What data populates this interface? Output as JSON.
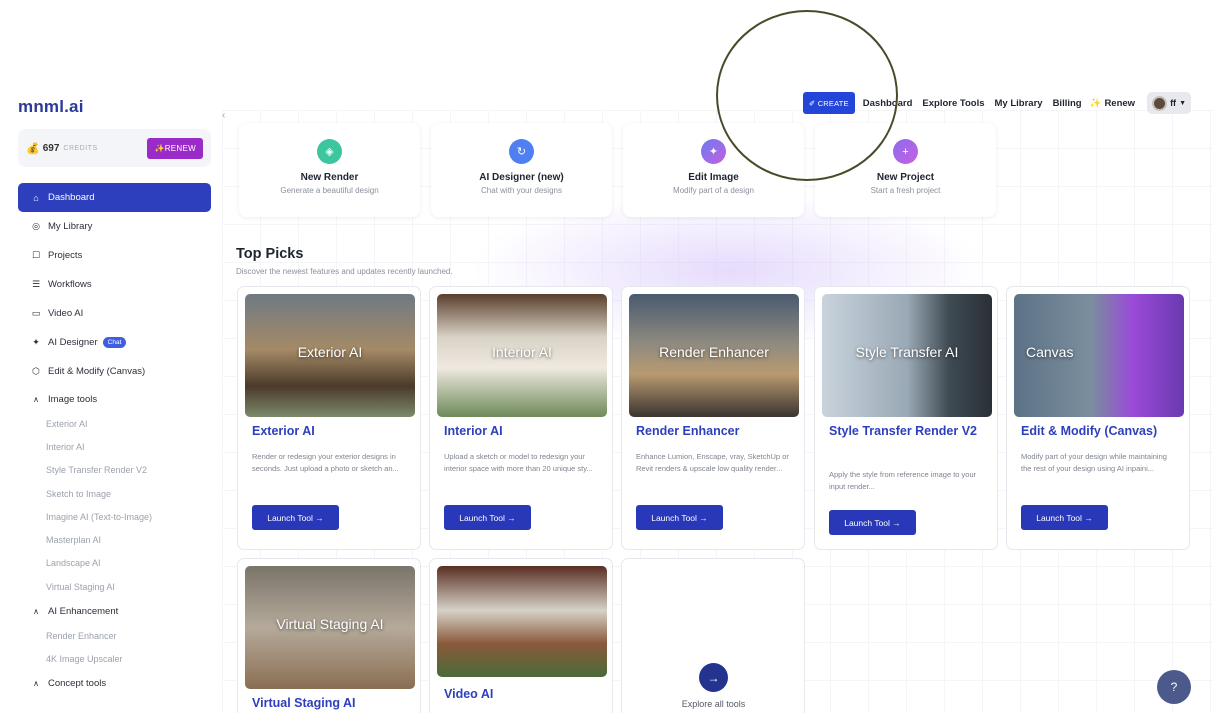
{
  "brand": "mnml.ai",
  "credits": {
    "count": "697",
    "label": "CREDITS",
    "renew": "✨RENEW"
  },
  "nav": [
    {
      "label": "Dashboard",
      "icon": "home-icon",
      "glyph": "⌂"
    },
    {
      "label": "My Library",
      "icon": "library-icon",
      "glyph": "◎"
    },
    {
      "label": "Projects",
      "icon": "projects-icon",
      "glyph": "☐"
    },
    {
      "label": "Workflows",
      "icon": "workflows-icon",
      "glyph": "☰"
    },
    {
      "label": "Video AI",
      "icon": "video-icon",
      "glyph": "▭"
    },
    {
      "label": "AI Designer",
      "icon": "sparkle-icon",
      "glyph": "✦",
      "badge": "Chat"
    },
    {
      "label": "Edit & Modify (Canvas)",
      "icon": "cube-icon",
      "glyph": "⬡"
    }
  ],
  "image_tools": {
    "label": "Image tools",
    "items": [
      "Exterior AI",
      "Interior AI",
      "Style Transfer Render V2",
      "Sketch to Image",
      "Imagine AI (Text-to-Image)",
      "Masterplan AI",
      "Landscape AI",
      "Virtual Staging AI"
    ]
  },
  "ai_enhancement": {
    "label": "AI Enhancement",
    "items": [
      "Render Enhancer",
      "4K Image Upscaler"
    ]
  },
  "concept_tools": {
    "label": "Concept tools"
  },
  "topbar": {
    "create": "✐ CREATE",
    "links": [
      "Dashboard",
      "Explore Tools",
      "My Library",
      "Billing"
    ],
    "renew": "Renew",
    "user": "ff"
  },
  "quick": [
    {
      "title": "New Render",
      "sub": "Generate a beautiful design",
      "color": "#3cc6a0",
      "glyph": "◈"
    },
    {
      "title": "AI Designer (new)",
      "sub": "Chat with your designs",
      "color": "#4f7ff0",
      "glyph": "↻"
    },
    {
      "title": "Edit Image",
      "sub": "Modify part of a design",
      "color": "#7e63f0",
      "glyph": "✦"
    },
    {
      "title": "New Project",
      "sub": "Start a fresh project",
      "color": "#a760e8",
      "glyph": "+"
    }
  ],
  "top_picks": {
    "title": "Top Picks",
    "sub": "Discover the newest features and updates recently launched."
  },
  "cards": [
    {
      "thumb": "Exterior AI",
      "title": "Exterior AI",
      "desc": "Render or redesign your exterior designs in seconds. Just upload a photo or sketch an...",
      "launch": "Launch Tool →"
    },
    {
      "thumb": "Interior AI",
      "title": "Interior AI",
      "desc": "Upload a sketch or model to redesign your interior space with more than 20 unique sty...",
      "launch": "Launch Tool →"
    },
    {
      "thumb": "Render Enhancer",
      "title": "Render Enhancer",
      "desc": "Enhance Lumion, Enscape, vray, SketchUp or Revit renders & upscale low quality render...",
      "launch": "Launch Tool →"
    },
    {
      "thumb": "Style Transfer AI",
      "title": "Style Transfer Render V2",
      "desc": "Apply the style from reference image to your input render...",
      "launch": "Launch Tool →"
    },
    {
      "thumb": "Canvas",
      "title": "Edit & Modify (Canvas)",
      "desc": "Modify part of your design while maintaining the rest of your design using AI inpaini...",
      "launch": "Launch Tool →"
    },
    {
      "thumb": "Virtual Staging AI",
      "title": "Virtual Staging AI"
    },
    {
      "thumb": "",
      "title": "Video AI"
    }
  ],
  "explore": "Explore all tools",
  "help": "?"
}
